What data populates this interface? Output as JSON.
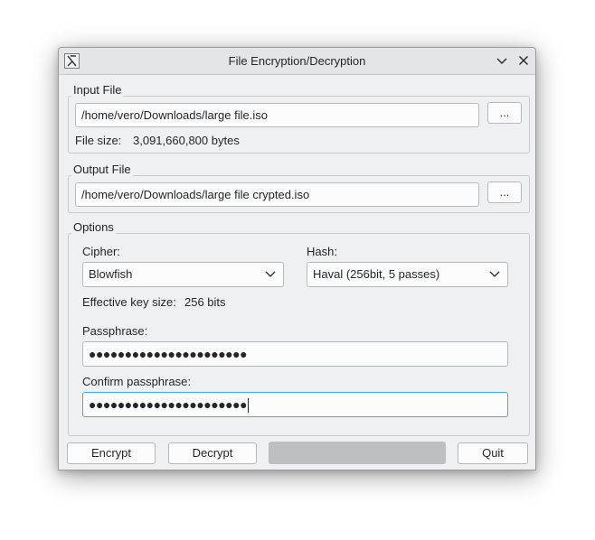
{
  "window": {
    "title": "File Encryption/Decryption"
  },
  "icons": {
    "app": "app-x-icon",
    "minimize": "chevron-down-icon",
    "close": "close-icon"
  },
  "input_file": {
    "legend": "Input File",
    "path": "/home/vero/Downloads/large file.iso",
    "browse_label": "...",
    "size_label": "File size:",
    "size_value": "3,091,660,800 bytes"
  },
  "output_file": {
    "legend": "Output File",
    "path": "/home/vero/Downloads/large file crypted.iso",
    "browse_label": "..."
  },
  "options": {
    "legend": "Options",
    "cipher_label": "Cipher:",
    "cipher_value": "Blowfish",
    "hash_label": "Hash:",
    "hash_value": "Haval (256bit, 5 passes)",
    "key_size_label": "Effective key size:",
    "key_size_value": "256 bits",
    "passphrase_label": "Passphrase:",
    "passphrase_mask": "●●●●●●●●●●●●●●●●●●●●●●",
    "confirm_label": "Confirm passphrase:",
    "confirm_mask": "●●●●●●●●●●●●●●●●●●●●●●"
  },
  "actions": {
    "encrypt_label": "Encrypt",
    "decrypt_label": "Decrypt",
    "quit_label": "Quit"
  },
  "colors": {
    "window_bg": "#eff0f1",
    "focus_accent": "#3daee9",
    "progress_bar": "#bdbfc2"
  }
}
